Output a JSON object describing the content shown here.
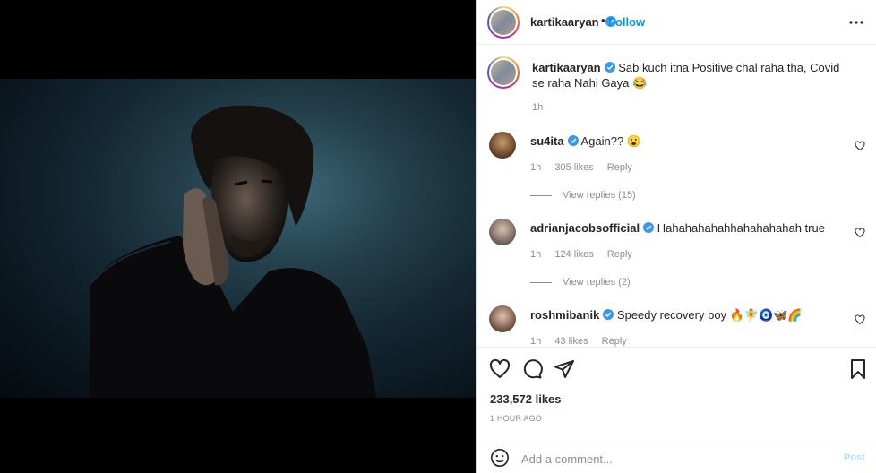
{
  "post": {
    "author": "kartikaaryan",
    "follow_label": "Follow",
    "follow_separator": "•",
    "caption_text": "Sab kuch itna Positive chal raha tha, Covid se raha Nahi Gaya 😂",
    "caption_time": "1h",
    "likes": "233,572 likes",
    "time_ago": "1 HOUR AGO"
  },
  "comments": [
    {
      "user": "su4ita",
      "text": "Again?? 😮",
      "time": "1h",
      "likes": "305 likes",
      "reply_label": "Reply",
      "view_replies": "View replies (15)"
    },
    {
      "user": "adrianjacobsofficial",
      "text": "Hahahahahahhahahahahah true",
      "time": "1h",
      "likes": "124 likes",
      "reply_label": "Reply",
      "view_replies": "View replies (2)"
    },
    {
      "user": "roshmibanik",
      "text": "Speedy recovery boy 🔥🧚🧿🦋🌈",
      "time": "1h",
      "likes": "43 likes",
      "reply_label": "Reply"
    }
  ],
  "add_comment": {
    "placeholder": "Add a comment...",
    "post_label": "Post"
  },
  "icons": {
    "more": "more-horizontal-icon",
    "like": "heart-icon",
    "comment": "comment-icon",
    "share": "paper-plane-icon",
    "save": "bookmark-icon",
    "emoji": "smiley-icon",
    "verified": "verified-badge-icon"
  },
  "colors": {
    "link_blue": "#0095f6",
    "post_disabled": "#b2dffc",
    "muted_text": "#8e8e8e",
    "verified_blue": "#3897f0"
  }
}
